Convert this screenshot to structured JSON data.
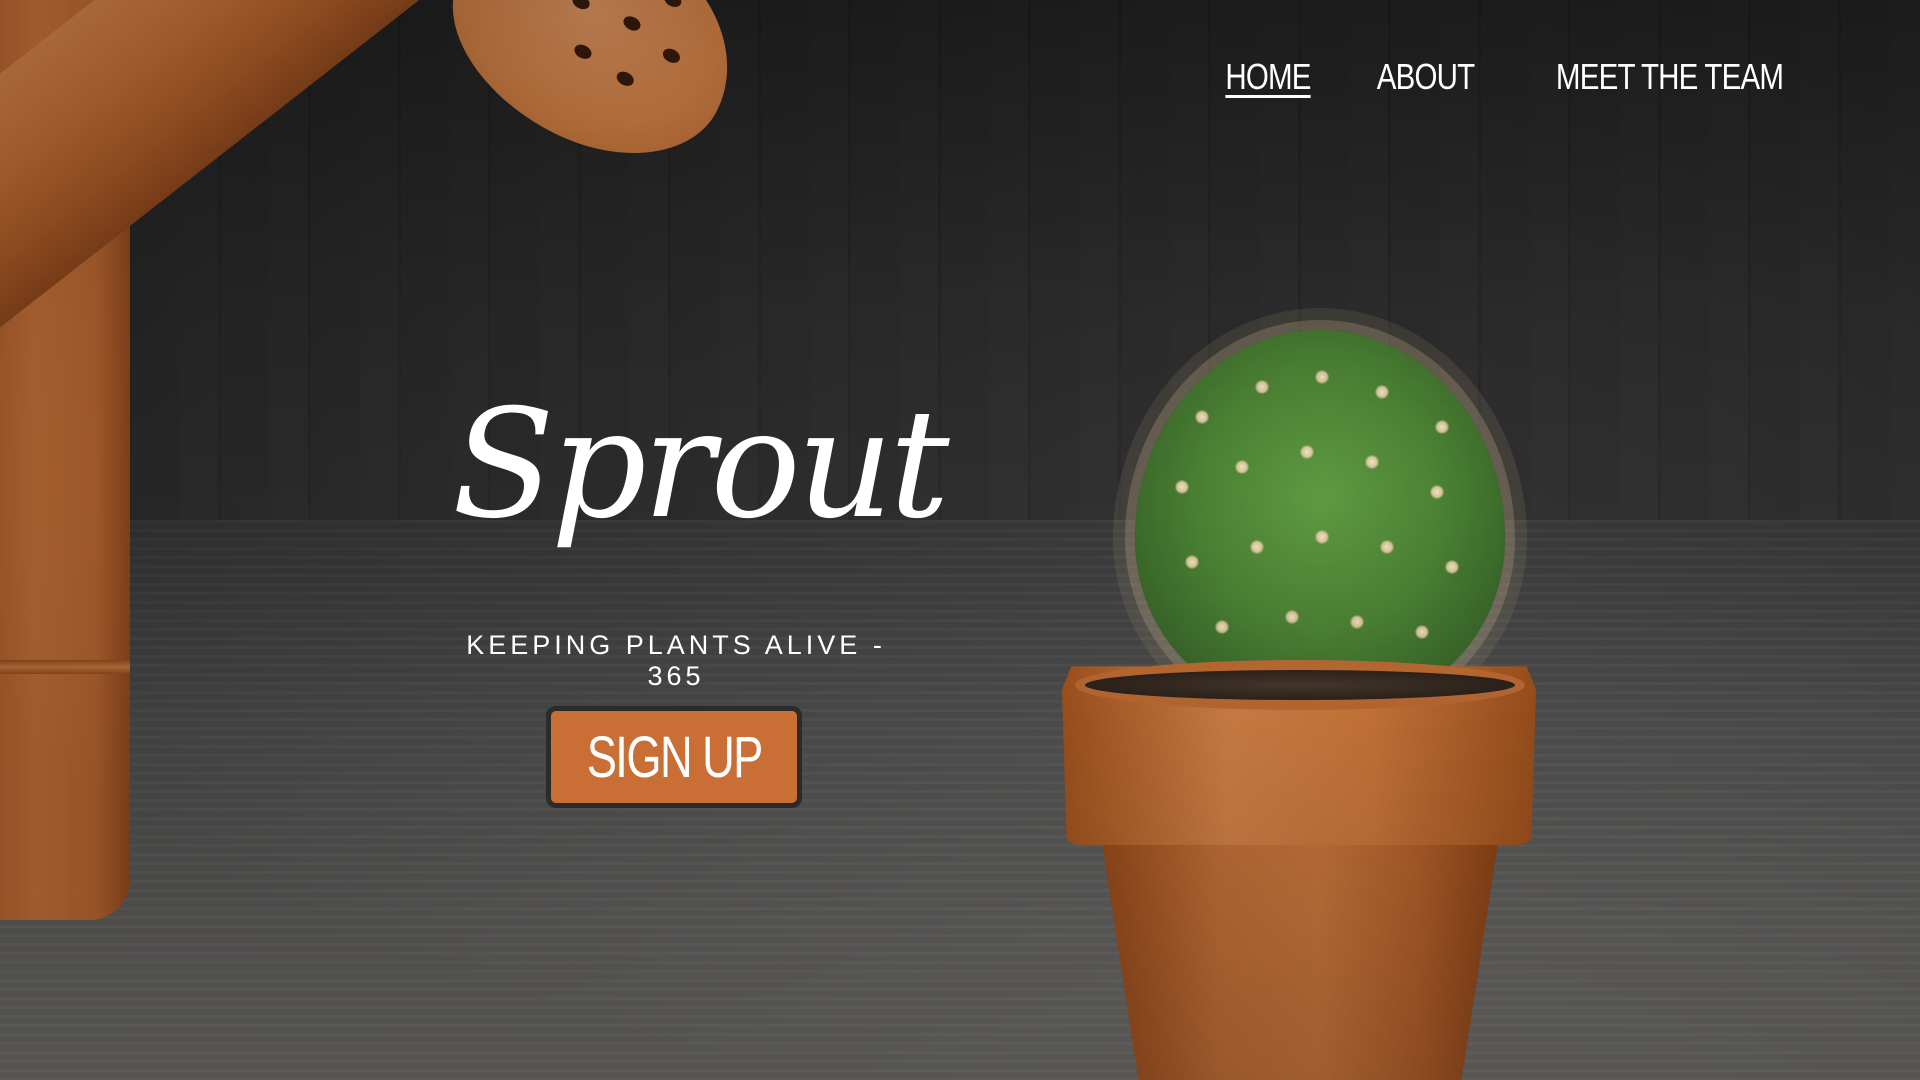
{
  "nav": {
    "items": [
      {
        "label": "HOME",
        "active": true
      },
      {
        "label": "ABOUT",
        "active": false
      },
      {
        "label": "MEET THE TEAM",
        "active": false
      }
    ]
  },
  "hero": {
    "brand": "Sprout",
    "tagline": "KEEPING PLANTS ALIVE - 365",
    "cta_label": "SIGN UP"
  },
  "colors": {
    "accent": "#c96f35",
    "text": "#ffffff",
    "button_border": "#2b2b2b",
    "background": "#1e1e1e"
  }
}
